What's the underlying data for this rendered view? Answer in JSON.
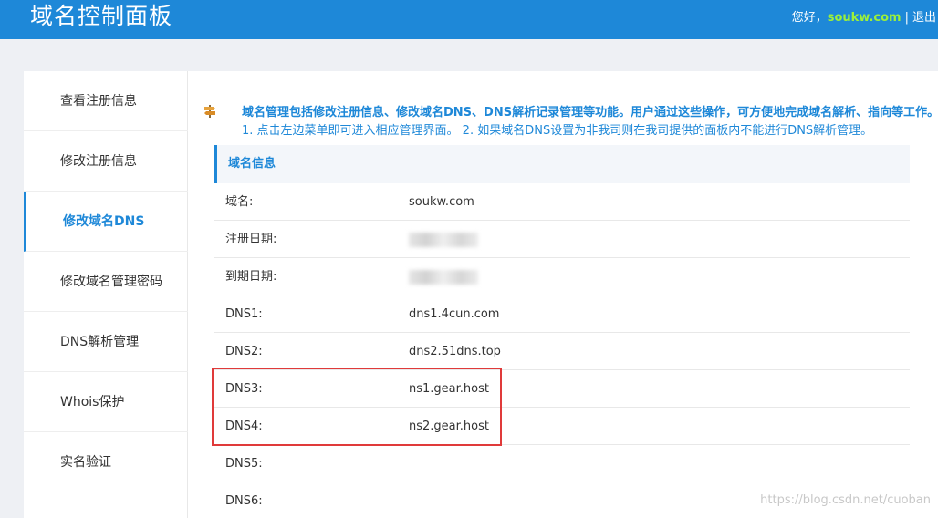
{
  "header": {
    "title": "域名控制面板",
    "greeting": "您好，",
    "username": "soukw.com",
    "separator": "|",
    "logout_label": "退出"
  },
  "sidebar": {
    "items": [
      {
        "label": "查看注册信息"
      },
      {
        "label": "修改注册信息"
      },
      {
        "label": "修改域名DNS",
        "active": true
      },
      {
        "label": "修改域名管理密码"
      },
      {
        "label": "DNS解析管理"
      },
      {
        "label": "Whois保护"
      },
      {
        "label": "实名验证"
      }
    ]
  },
  "notice": {
    "icon": "signpost-icon",
    "line1": "域名管理包括修改注册信息、修改域名DNS、DNS解析记录管理等功能。用户通过这些操作，可方便地完成域名解析、指向等工作。",
    "line2": "1. 点击左边菜单即可进入相应管理界面。 2. 如果域名DNS设置为非我司则在我司提供的面板内不能进行DNS解析管理。"
  },
  "domain_info": {
    "heading": "域名信息",
    "rows": [
      {
        "label": "域名:",
        "value": "soukw.com"
      },
      {
        "label": "注册日期:",
        "value": ""
      },
      {
        "label": "到期日期:",
        "value": ""
      },
      {
        "label": "DNS1:",
        "value": "dns1.4cun.com"
      },
      {
        "label": "DNS2:",
        "value": "dns2.51dns.top"
      },
      {
        "label": "DNS3:",
        "value": "ns1.gear.host"
      },
      {
        "label": "DNS4:",
        "value": "ns2.gear.host"
      },
      {
        "label": "DNS5:",
        "value": ""
      },
      {
        "label": "DNS6:",
        "value": ""
      }
    ]
  },
  "colors": {
    "header_bg": "#1e88d8",
    "accent": "#1e88d8",
    "username": "#9cf03a",
    "highlight_border": "#e03a3a"
  },
  "watermark": "https://blog.csdn.net/cuoban"
}
